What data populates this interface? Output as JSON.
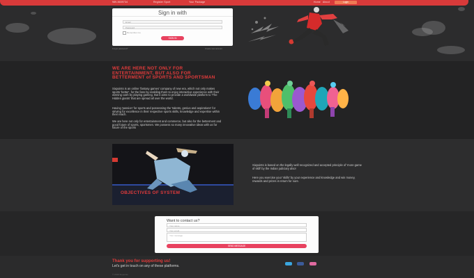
{
  "colors": {
    "accent": "#d83a3a",
    "heading": "#e23b3b",
    "button": "#e8425f",
    "twitter": "#3aa6e0",
    "facebook": "#3b5b9a",
    "instagram": "#e06aa0"
  },
  "nav": {
    "phone": "989-5659734",
    "link1": "Register Sport",
    "link2": "Your Package",
    "home": "Home",
    "about": "About",
    "cta": "Login"
  },
  "signin": {
    "title": "Sign in with",
    "email_placeholder": "Email",
    "password_placeholder": "Password",
    "remember": "Remember me",
    "submit": "SIGN IN",
    "footer_left": "Forgot password?",
    "footer_right": "Create new account"
  },
  "about": {
    "title": "WE ARE HERE NOT ONLY FOR ENTERTAINMENT, BUT ALSO FOR BETTERMENT of SPORTS AND SPORTSMAN",
    "p1": "Sixpoints is an online 'fantasy games' company of new era, which not only makes sports 'better', for the fans by enabling them to enjoy interactive experience with their winning cash by playing gaming. But it aims to provide a worldwide platform to 'The Hidden giants' that are spread all over the world.",
    "p2": "Having 'passion' for sports and possessing the 'talents, genius and aspirations' for striving for excellence in their respective sports skills, knowledge and expertise within their reach.",
    "p3": "We are here not only for entertainment and commerce, but also for the betterment and good future of sports, sportsmen. We possess so many innovative ideas with us for future of the sports"
  },
  "objectives": {
    "title": "OBJECTIVES OF SYSTEM",
    "p1": "Sixpoints is based on the legally well recognized and accepted principle of 'more game of skill' by the Indian judiciary also!",
    "p2": "Here you exercise your 'skills' by your experience and knowledge and win money, rewards and prizes in return for sure."
  },
  "contact": {
    "title": "Want to contact us?",
    "name_placeholder": "Your name",
    "email_placeholder": "Your email",
    "message_placeholder": "Your message",
    "submit": "SEND MESSAGE"
  },
  "footer": {
    "title": "Thank you for supporting us!",
    "subtitle": "Let's get in touch on any of these platforms.",
    "copyright": "© 2019 Sixpoints"
  }
}
